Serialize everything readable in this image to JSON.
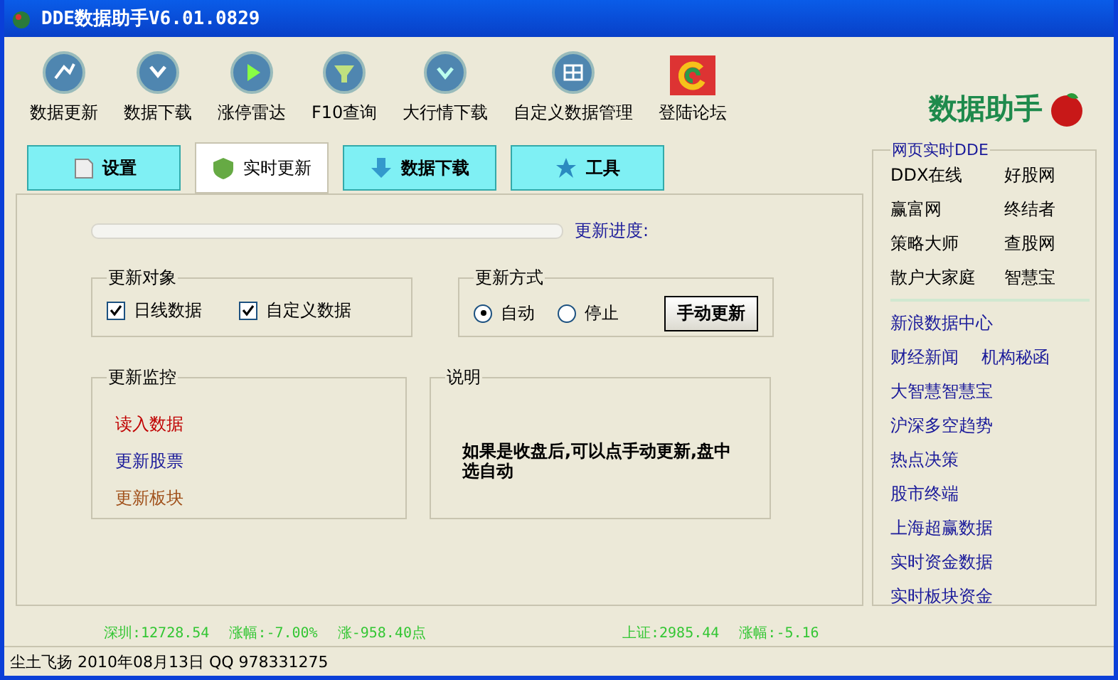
{
  "window": {
    "title": "DDE数据助手V6.01.0829"
  },
  "toolbar": [
    {
      "label": "数据更新"
    },
    {
      "label": "数据下载"
    },
    {
      "label": "涨停雷达"
    },
    {
      "label": "F10查询"
    },
    {
      "label": "大行情下载"
    },
    {
      "label": "自定义数据管理"
    },
    {
      "label": "登陆论坛"
    }
  ],
  "logo": {
    "text": "数据助手"
  },
  "tabs": [
    {
      "label": "设置",
      "selected": false
    },
    {
      "label": "实时更新",
      "selected": true
    },
    {
      "label": "数据下载",
      "selected": false
    },
    {
      "label": "工具",
      "selected": false
    }
  ],
  "progress": {
    "label": "更新进度:",
    "level": 0
  },
  "update_targets": {
    "title": "更新对象",
    "options": [
      {
        "label": "日线数据",
        "checked": true
      },
      {
        "label": "自定义数据",
        "checked": true
      }
    ]
  },
  "update_mode": {
    "title": "更新方式",
    "options": [
      {
        "label": "自动",
        "selected": true
      },
      {
        "label": "停止",
        "selected": false
      }
    ],
    "button": "手动更新"
  },
  "monitor": {
    "title": "更新监控",
    "items": [
      {
        "label": "读入数据",
        "color": "#c00000"
      },
      {
        "label": "更新股票",
        "color": "#1a1a9a"
      },
      {
        "label": "更新板块",
        "color": "#a0501a"
      }
    ]
  },
  "description": {
    "title": "说明",
    "text": "如果是收盘后,可以点手动更新,盘中选自动"
  },
  "sidebar": {
    "title": "网页实时DDE",
    "sites": [
      [
        "DDX在线",
        "好股网"
      ],
      [
        "赢富网",
        "终结者"
      ],
      [
        "策略大师",
        "查股网"
      ],
      [
        "散户大家庭",
        "智慧宝"
      ]
    ],
    "links": [
      [
        "新浪数据中心"
      ],
      [
        "财经新闻",
        "机构秘函"
      ],
      [
        "大智慧智慧宝"
      ],
      [
        "沪深多空趋势"
      ],
      [
        "热点决策"
      ],
      [
        "股市终端"
      ],
      [
        "上海超赢数据"
      ],
      [
        "实时资金数据"
      ],
      [
        "实时板块资金"
      ]
    ]
  },
  "ticker": {
    "left": [
      "深圳:12728.54",
      "涨幅:-7.00%",
      "涨-958.40点"
    ],
    "right": [
      "上证:2985.44",
      "涨幅:-5.16"
    ]
  },
  "status_bar": {
    "text": "尘土飞扬 2010年08月13日 QQ 978331275"
  }
}
